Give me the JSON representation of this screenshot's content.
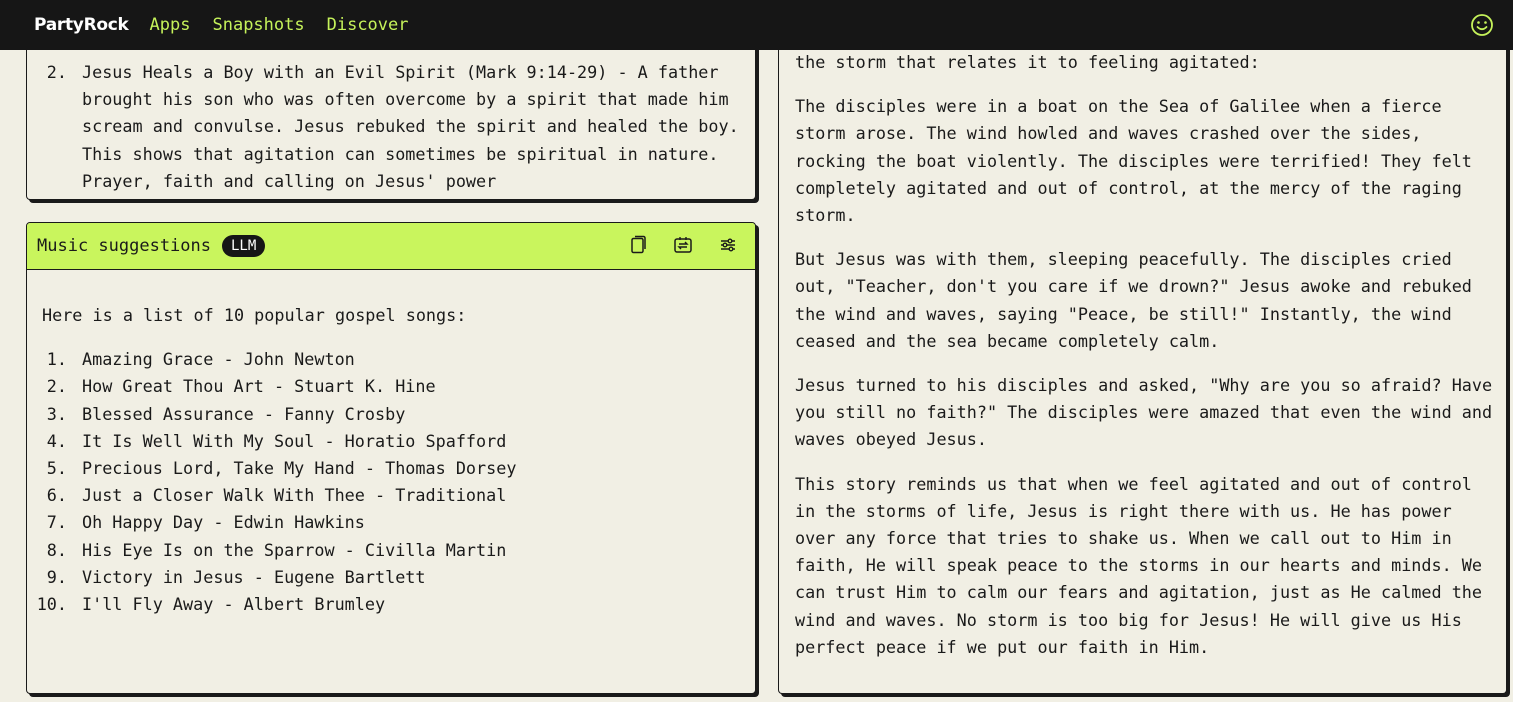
{
  "nav": {
    "brand": "PartyRock",
    "links": [
      "Apps",
      "Snapshots",
      "Discover"
    ],
    "profile_icon": "smiley-icon"
  },
  "scripture_panel": {
    "item_number": "2.",
    "item_text": "Jesus Heals a Boy with an Evil Spirit (Mark 9:14-29) - A father brought his son who was often overcome by a spirit that made him scream and convulse. Jesus rebuked the spirit and healed the boy. This shows that agitation can sometimes be spiritual in nature. Prayer, faith and calling on Jesus' power"
  },
  "music_panel": {
    "title": "Music suggestions",
    "badge": "LLM",
    "icons": [
      "copy-icon",
      "remix-icon",
      "settings-sliders-icon"
    ],
    "intro": "Here is a list of 10 popular gospel songs:",
    "songs": [
      {
        "n": "1.",
        "text": "Amazing Grace - John Newton"
      },
      {
        "n": "2.",
        "text": "How Great Thou Art - Stuart K. Hine"
      },
      {
        "n": "3.",
        "text": "Blessed Assurance - Fanny Crosby"
      },
      {
        "n": "4.",
        "text": "It Is Well With My Soul - Horatio Spafford"
      },
      {
        "n": "5.",
        "text": "Precious Lord, Take My Hand - Thomas Dorsey"
      },
      {
        "n": "6.",
        "text": "Just a Closer Walk With Thee - Traditional"
      },
      {
        "n": "7.",
        "text": "Oh Happy Day - Edwin Hawkins"
      },
      {
        "n": "8.",
        "text": "His Eye Is on the Sparrow - Civilla Martin"
      },
      {
        "n": "9.",
        "text": "Victory in Jesus - Eugene Bartlett"
      },
      {
        "n": "10.",
        "text": "I'll Fly Away - Albert Brumley"
      }
    ]
  },
  "story_panel": {
    "paragraphs": [
      "the storm that relates it to feeling agitated:",
      "The disciples were in a boat on the Sea of Galilee when a fierce storm arose. The wind howled and waves crashed over the sides, rocking the boat violently. The disciples were terrified! They felt completely agitated and out of control, at the mercy of the raging storm.",
      "But Jesus was with them, sleeping peacefully. The disciples cried out, \"Teacher, don't you care if we drown?\" Jesus awoke and rebuked the wind and waves, saying \"Peace, be still!\" Instantly, the wind ceased and the sea became completely calm.",
      "Jesus turned to his disciples and asked, \"Why are you so afraid? Have you still no faith?\" The disciples were amazed that even the wind and waves obeyed Jesus.",
      "This story reminds us that when we feel agitated and out of control in the storms of life, Jesus is right there with us. He has power over any force that tries to shake us. When we call out to Him in faith, He will speak peace to the storms in our hearts and minds. We can trust Him to calm our fears and agitation, just as He calmed the wind and waves. No storm is too big for Jesus! He will give us His perfect peace if we put our faith in Him."
    ]
  }
}
